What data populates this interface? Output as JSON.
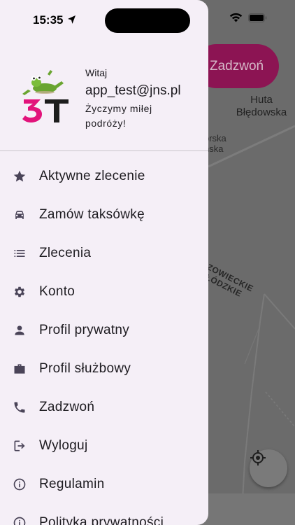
{
  "status_bar": {
    "time": "15:35"
  },
  "map": {
    "call_button_label": "Zadzwoń",
    "place_label": "Huta Błędowska",
    "road_label_line1": "orska",
    "road_label_line2": "ńska",
    "region_label_line1": "AZOWIECKIE",
    "region_label_line2": "ŁÓDZKIE"
  },
  "drawer": {
    "greeting": "Witaj",
    "email": "app_test@jns.pl",
    "wish": "Życzymy miłej podróży!",
    "menu": [
      {
        "label": "Aktywne zlecenie",
        "icon": "star-icon"
      },
      {
        "label": "Zamów taksówkę",
        "icon": "taxi-icon"
      },
      {
        "label": "Zlecenia",
        "icon": "list-icon"
      },
      {
        "label": "Konto",
        "icon": "gear-icon"
      },
      {
        "label": "Profil prywatny",
        "icon": "person-icon"
      },
      {
        "label": "Profil służbowy",
        "icon": "briefcase-icon"
      },
      {
        "label": "Zadzwoń",
        "icon": "phone-icon"
      },
      {
        "label": "Wyloguj",
        "icon": "logout-icon"
      },
      {
        "label": "Regulamin",
        "icon": "info-icon"
      },
      {
        "label": "Polityka prywatności",
        "icon": "info-icon"
      }
    ]
  },
  "colors": {
    "drawer_bg": "#f5eff7",
    "brand_magenta": "#e2137b",
    "scrim_map": "#6b6b6b",
    "call_pill": "#8c1453"
  }
}
